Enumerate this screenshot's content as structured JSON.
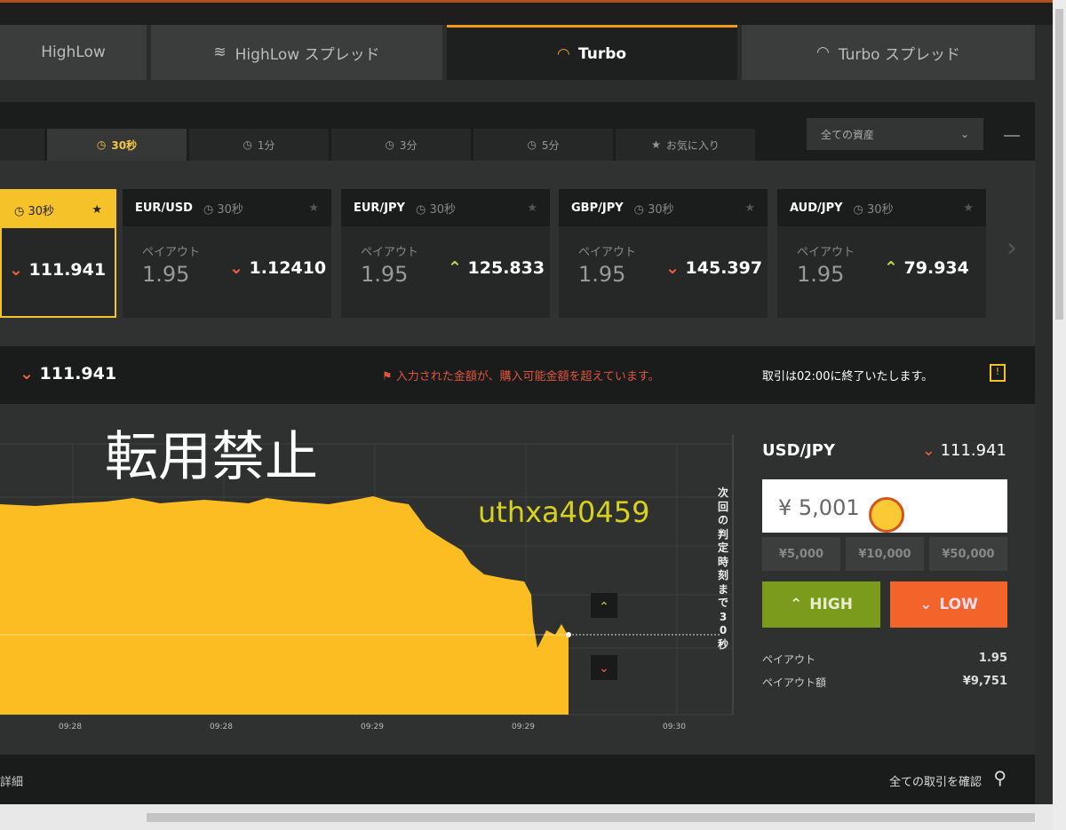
{
  "top_tabs": [
    {
      "label": "HighLow"
    },
    {
      "label": "HighLow スプレッド"
    },
    {
      "label": "Turbo",
      "active": true
    },
    {
      "label": "Turbo スプレッド"
    }
  ],
  "sub_tabs": [
    {
      "label": "30秒",
      "active": true
    },
    {
      "label": "1分"
    },
    {
      "label": "3分"
    },
    {
      "label": "5分"
    },
    {
      "label": "お気に入り"
    }
  ],
  "asset_filter": "全ての資産",
  "cards": [
    {
      "time": "30秒",
      "rate": "111.941",
      "dir": "down",
      "selected": true
    },
    {
      "pair": "EUR/USD",
      "time": "30秒",
      "payout_label": "ペイアウト",
      "payout": "1.95",
      "rate": "1.12410",
      "dir": "down"
    },
    {
      "pair": "EUR/JPY",
      "time": "30秒",
      "payout_label": "ペイアウト",
      "payout": "1.95",
      "rate": "125.833",
      "dir": "up"
    },
    {
      "pair": "GBP/JPY",
      "time": "30秒",
      "payout_label": "ペイアウト",
      "payout": "1.95",
      "rate": "145.397",
      "dir": "down"
    },
    {
      "pair": "AUD/JPY",
      "time": "30秒",
      "payout_label": "ペイアウト",
      "payout": "1.95",
      "rate": "79.934",
      "dir": "up"
    }
  ],
  "info_bar": {
    "rate": "111.941",
    "warning": "入力された金額が、購入可能金額を超えています。",
    "closing": "取引は02:00に終了いたします。"
  },
  "chart": {
    "x_ticks": [
      "09:28",
      "09:28",
      "09:29",
      "09:29",
      "09:30"
    ],
    "countdown": "次回の判定時刻まで30秒",
    "colors": {
      "area": "#fbbd22"
    }
  },
  "watermark": {
    "text": "転用禁止",
    "id": "uthxa40459"
  },
  "trade_panel": {
    "pair": "USD/JPY",
    "rate": "111.941",
    "amount": "¥ 5,001",
    "presets": [
      "¥5,000",
      "¥10,000",
      "¥50,000"
    ],
    "high": "HIGH",
    "low": "LOW",
    "payout_label": "ペイアウト",
    "payout": "1.95",
    "payout_amount_label": "ペイアウト額",
    "payout_amount": "¥9,751",
    "colors": {
      "high": "#7a9b1c",
      "low": "#f2642a"
    }
  },
  "bottom_bar": {
    "left": "詳細",
    "right": "全ての取引を確認"
  }
}
